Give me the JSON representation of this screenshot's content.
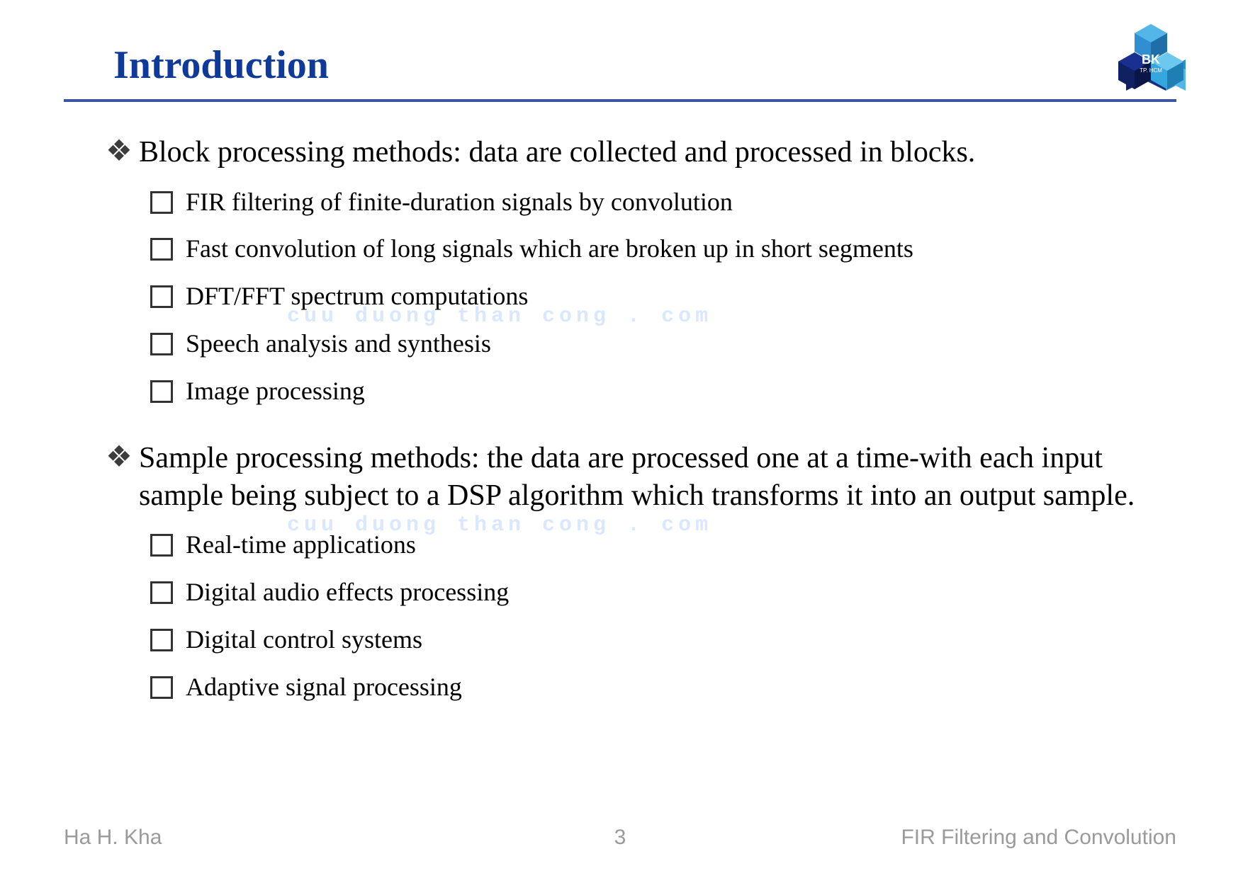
{
  "title": "Introduction",
  "logo": {
    "text_top": "BK",
    "text_bottom": "TP. HCM"
  },
  "colors": {
    "title": "#103a9a",
    "rule": "#3c56a0",
    "footer": "#9a9a9a"
  },
  "bullets": [
    {
      "text": "Block processing methods: data are collected and processed in blocks.",
      "subitems": [
        "FIR filtering of finite-duration signals by convolution",
        "Fast convolution of long signals which are broken up in short segments",
        "DFT/FFT spectrum computations",
        "Speech analysis and synthesis",
        "Image processing"
      ]
    },
    {
      "text": "Sample processing methods: the data are processed one at a time-with each input sample being subject to a DSP algorithm which transforms it into an output sample.",
      "subitems": [
        "Real-time applications",
        "Digital audio effects processing",
        "Digital control systems",
        "Adaptive signal processing"
      ]
    }
  ],
  "watermark": "cuu duong than cong . com",
  "footer": {
    "left": "Ha H. Kha",
    "page": "3",
    "right": "FIR Filtering and Convolution"
  }
}
